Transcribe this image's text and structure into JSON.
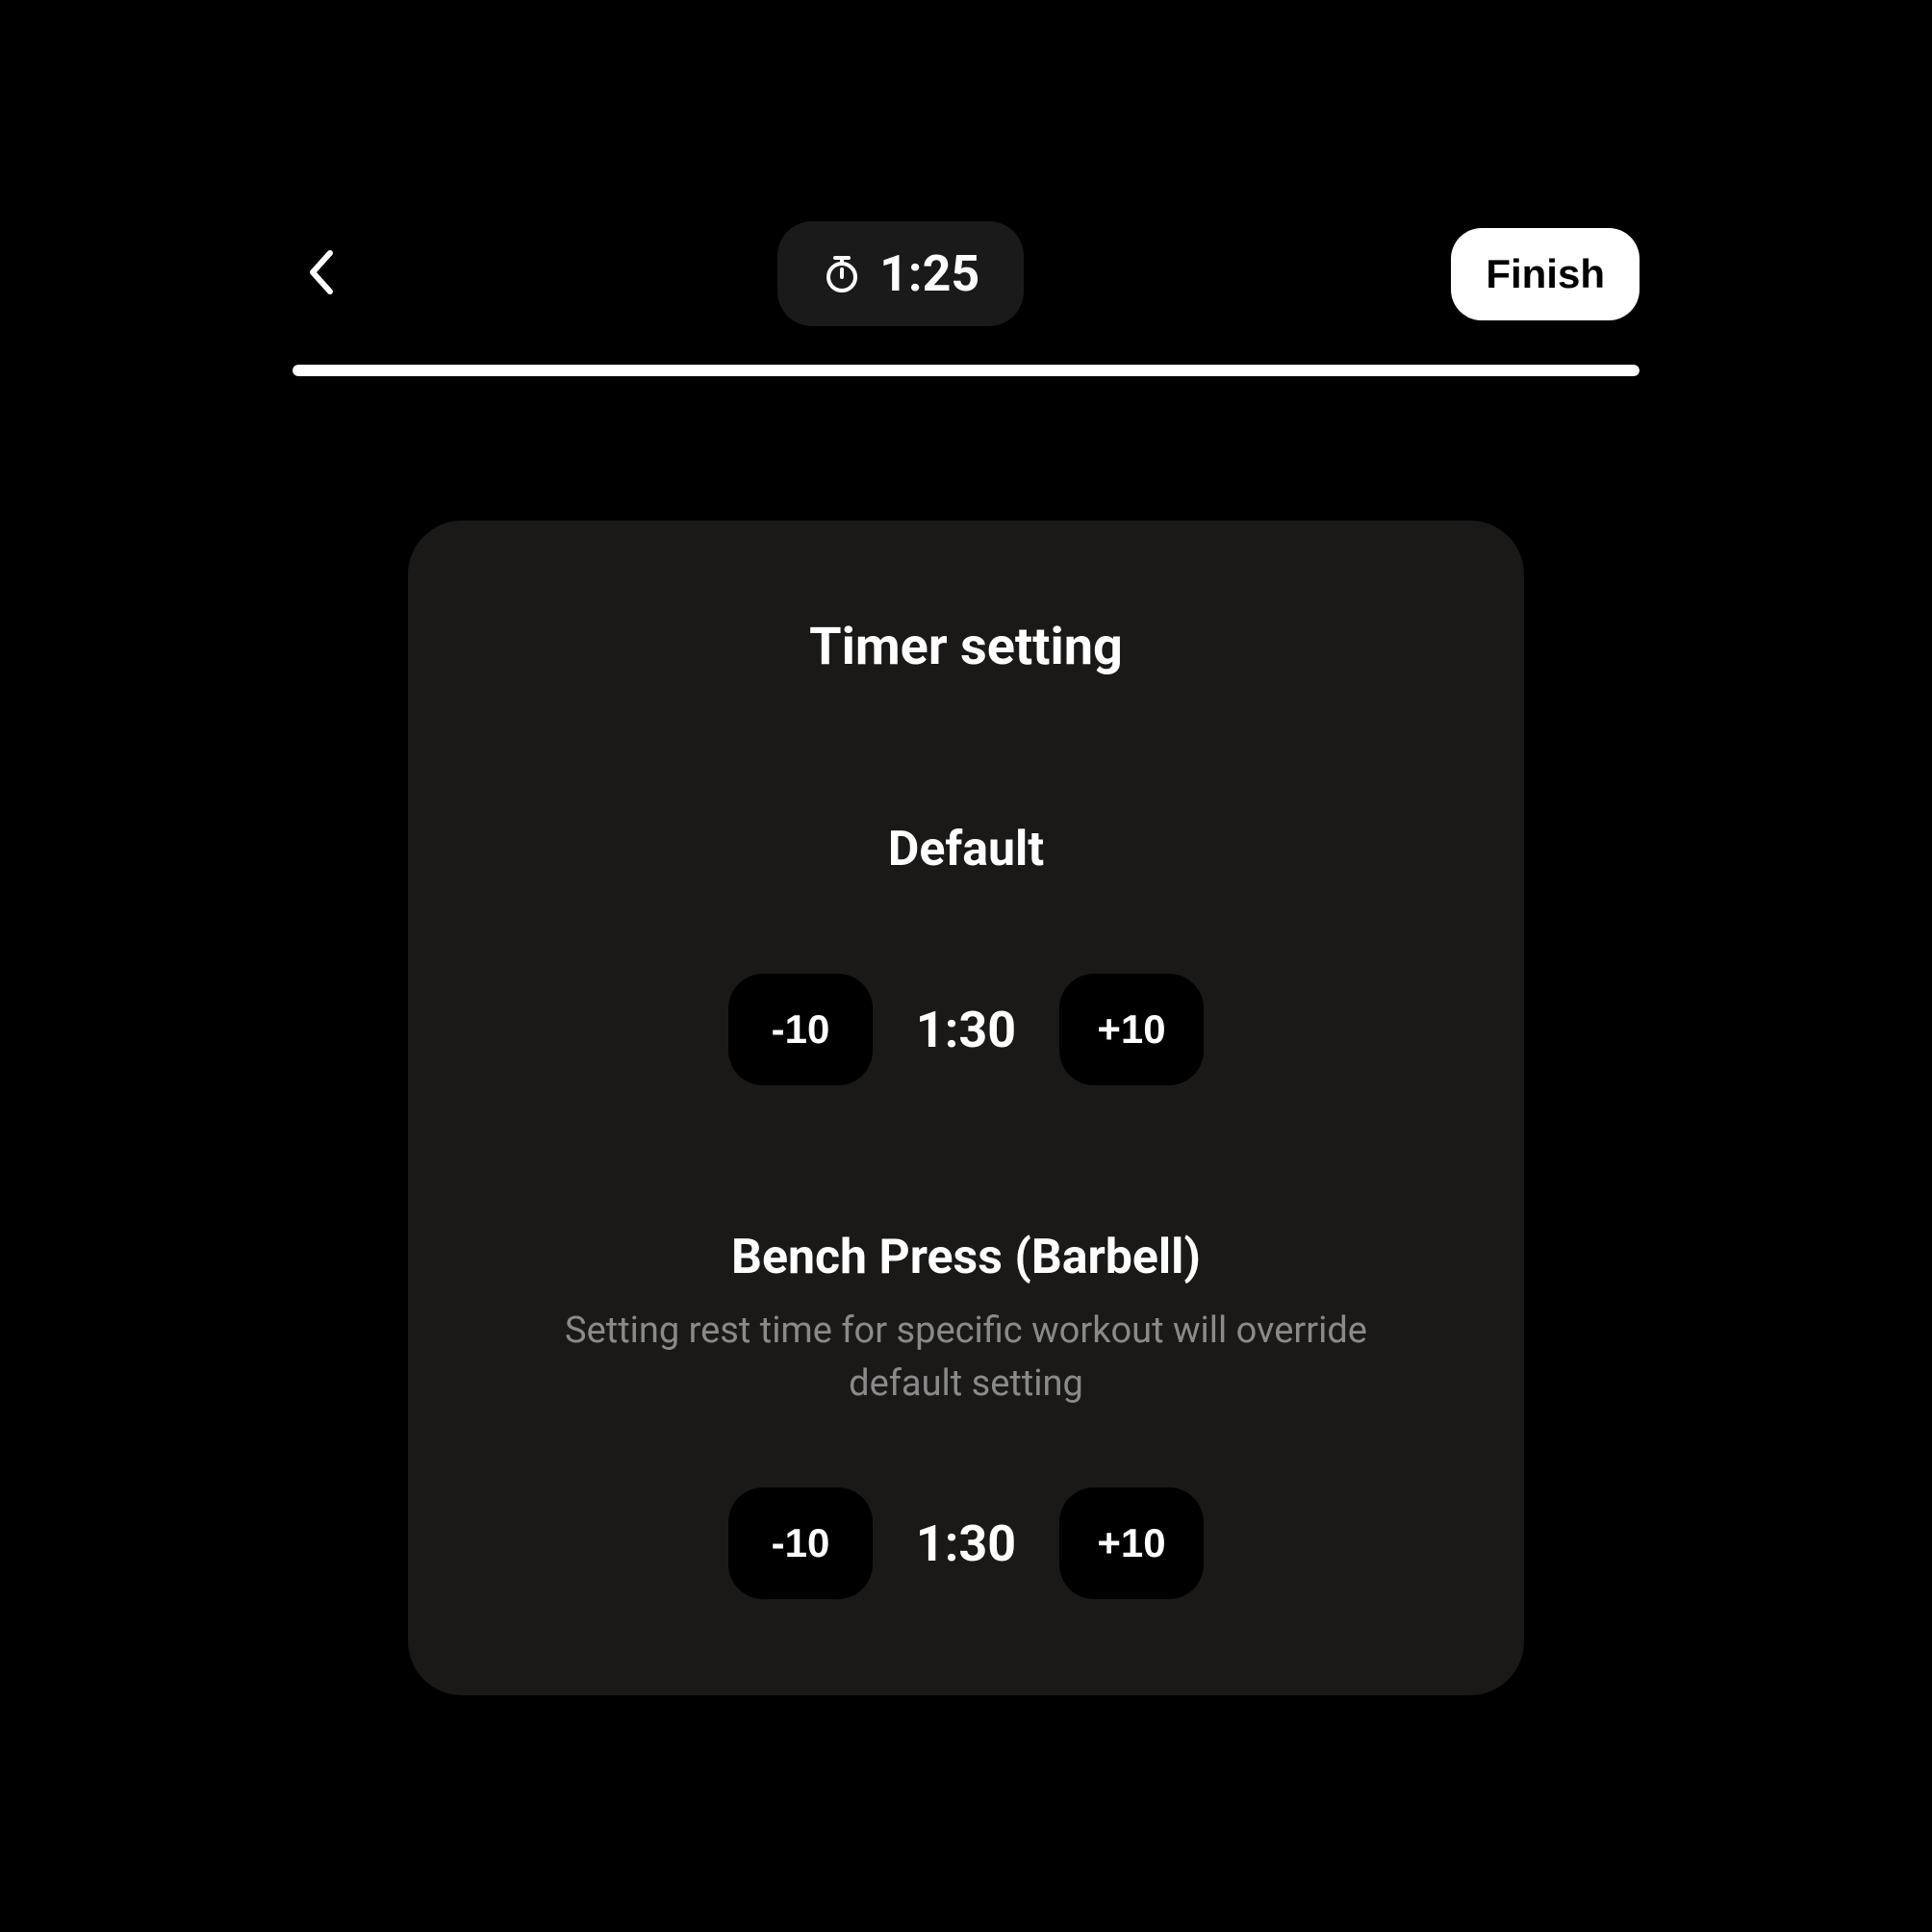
{
  "header": {
    "timer": "1:25",
    "finish_label": "Finish",
    "progress_percent": 100
  },
  "modal": {
    "title": "Timer setting",
    "sections": [
      {
        "label": "Default",
        "subtext": null,
        "minus_label": "-10",
        "value": "1:30",
        "plus_label": "+10"
      },
      {
        "label": "Bench Press (Barbell)",
        "subtext": "Setting rest time for specific workout will override default setting",
        "minus_label": "-10",
        "value": "1:30",
        "plus_label": "+10"
      }
    ]
  }
}
